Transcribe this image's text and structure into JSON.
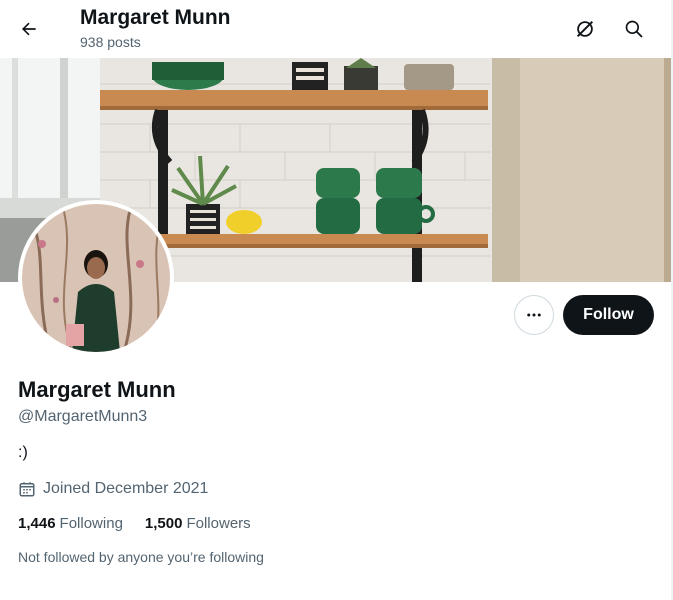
{
  "header": {
    "title": "Margaret Munn",
    "post_count": "938 posts",
    "back_icon": "arrow-left-icon",
    "grok_icon": "grok-icon",
    "search_icon": "search-icon"
  },
  "profile": {
    "name": "Margaret Munn",
    "handle": "@MargaretMunn3",
    "bio": ":)",
    "joined": "Joined December 2021",
    "following_count": "1,446",
    "following_label": "Following",
    "followers_count": "1,500",
    "followers_label": "Followers",
    "mutual_note": "Not followed by anyone you’re following"
  },
  "actions": {
    "follow_label": "Follow",
    "more_icon": "more-icon"
  },
  "colors": {
    "text_primary": "#0f1419",
    "text_secondary": "#536471",
    "follow_bg": "#0f1419",
    "border": "#cfd9de"
  }
}
